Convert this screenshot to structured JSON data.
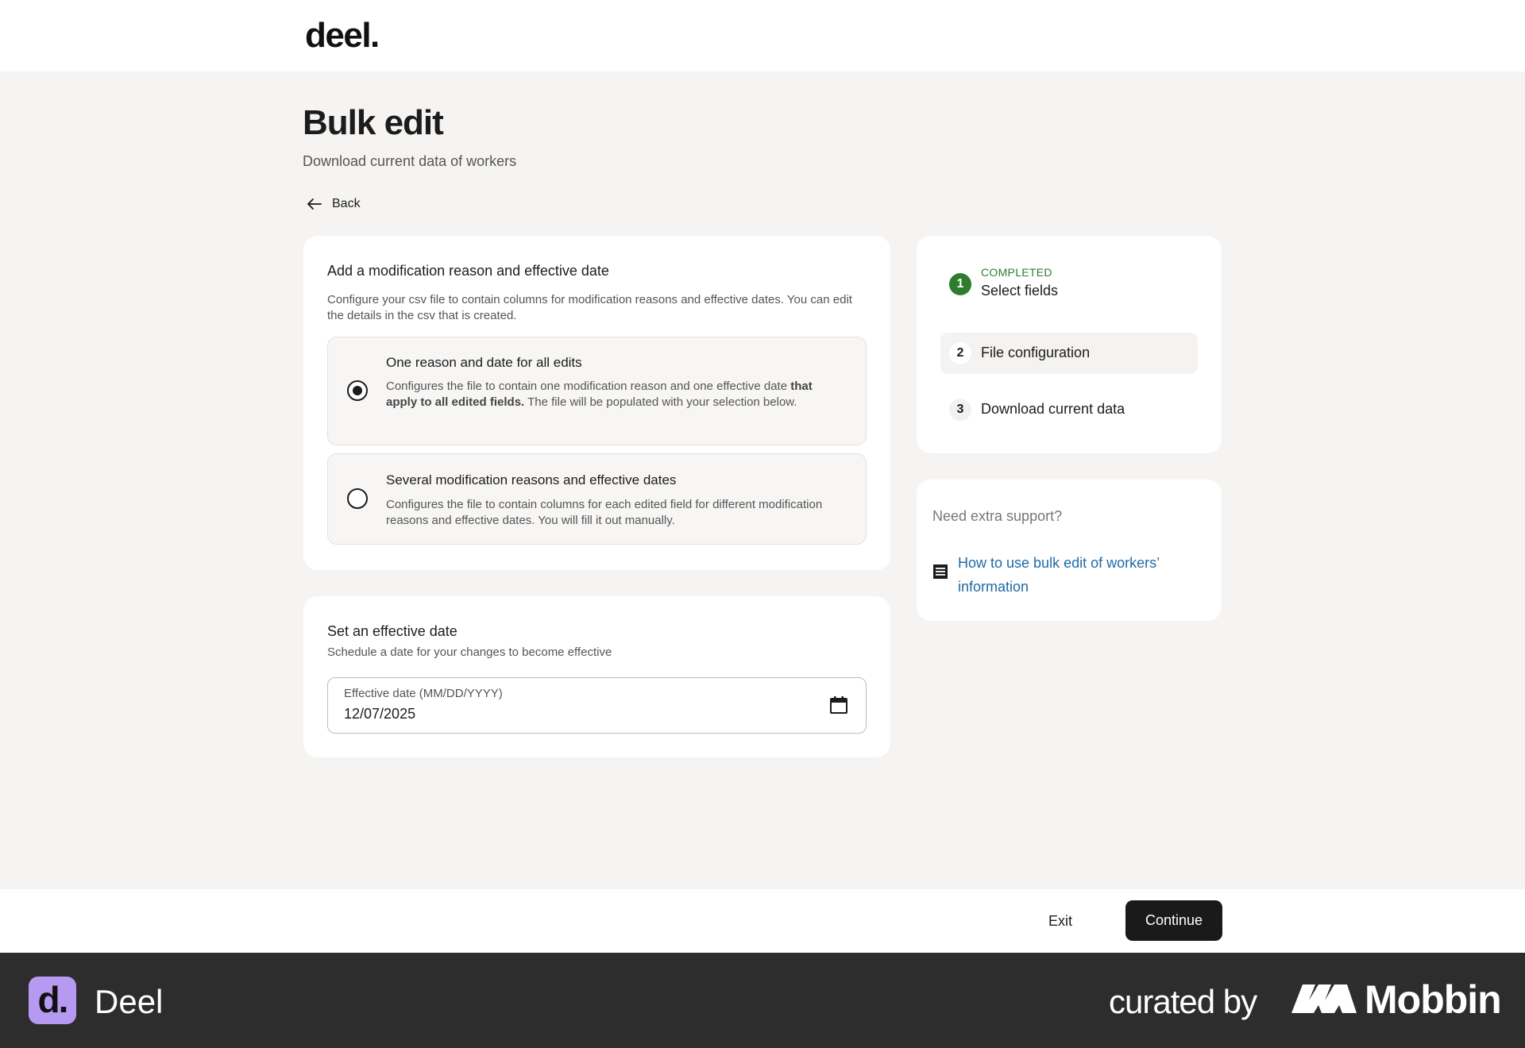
{
  "header": {
    "logo": "deel."
  },
  "page": {
    "title": "Bulk edit",
    "subtitle": "Download current data of workers",
    "back_label": "Back"
  },
  "reason_card": {
    "title": "Add a modification reason and effective date",
    "description": "Configure your csv file to contain columns for modification reasons and effective dates. You can edit the details in the csv that is created.",
    "options": [
      {
        "label": "One reason and date for all edits",
        "desc_pre": "Configures the file to contain one modification reason and one effective date ",
        "desc_bold": "that apply to all edited fields.",
        "desc_post": " The file will be populated with your selection below.",
        "selected": true
      },
      {
        "label": "Several modification reasons and effective dates",
        "desc": "Configures the file to contain columns for each edited field for different modification reasons and effective dates. You will fill it out manually.",
        "selected": false
      }
    ]
  },
  "date_card": {
    "title": "Set an effective date",
    "description": "Schedule a date for your changes to become effective",
    "field_label": "Effective date (MM/DD/YYYY)",
    "field_value": "12/07/2025",
    "icon": "calendar-icon"
  },
  "steps": [
    {
      "number": "1",
      "status": "COMPLETED",
      "label": "Select fields"
    },
    {
      "number": "2",
      "label": "File configuration"
    },
    {
      "number": "3",
      "label": "Download current data"
    }
  ],
  "support": {
    "title": "Need extra support?",
    "link": "How to use bulk edit of workers’ information",
    "icon": "article-icon"
  },
  "footer": {
    "exit_label": "Exit",
    "continue_label": "Continue"
  },
  "brand_bar": {
    "app_icon_letter": "d.",
    "app_name": "Deel",
    "curated_label": "curated by",
    "mobbin_name": "Mobbin"
  },
  "colors": {
    "background": "#f5f4f2",
    "card": "#ffffff",
    "completed_green": "#2e7d2e",
    "link_blue": "#1f6aa5",
    "primary_button": "#1a1a1a",
    "brand_bar": "#2d2d2d",
    "app_icon": "#b69af2"
  }
}
